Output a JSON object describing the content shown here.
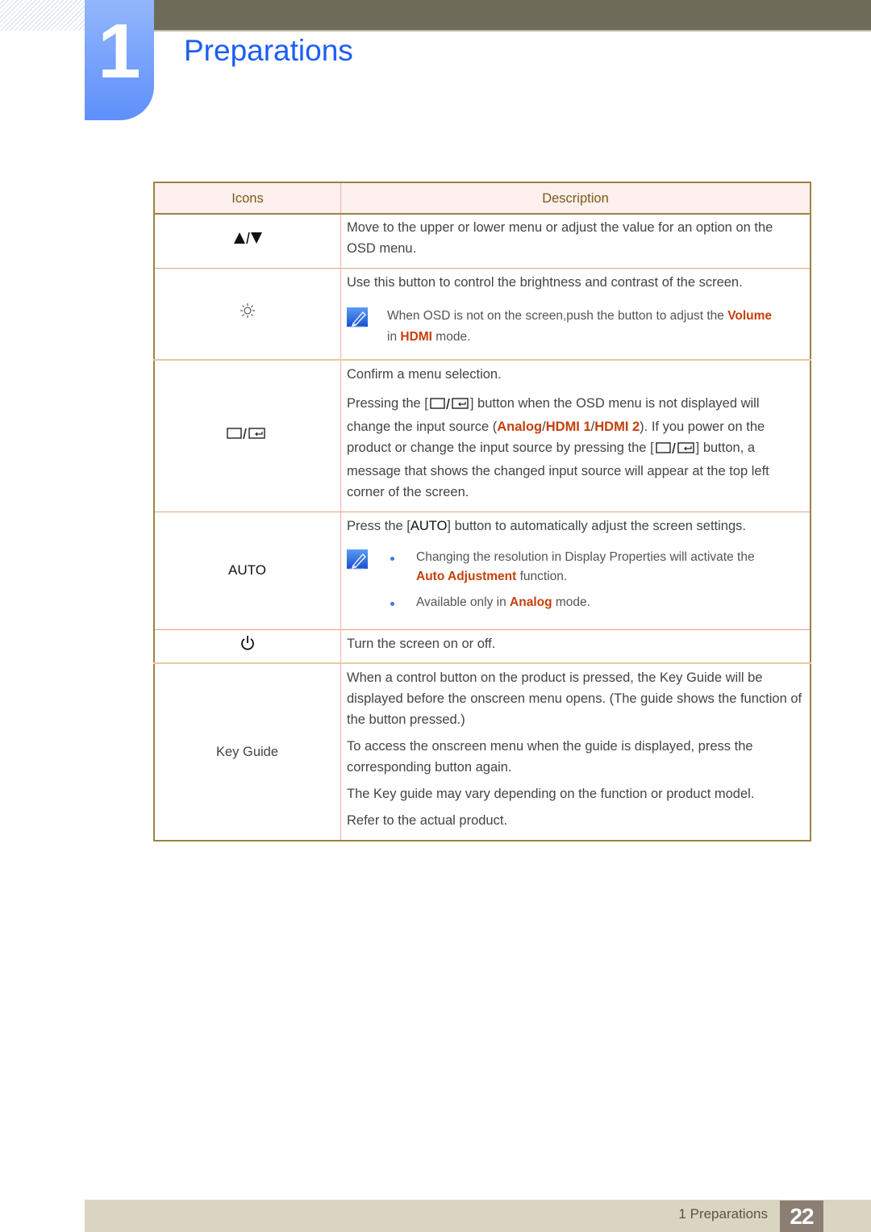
{
  "chapter": {
    "number": "1",
    "title": "Preparations"
  },
  "colors": {
    "accent_blue": "#1c5ef5",
    "highlight_red": "#c5400c",
    "header_text": "#7a5a12",
    "border": "#9b8442"
  },
  "table": {
    "headers": {
      "icons": "Icons",
      "description": "Description"
    },
    "rows": [
      {
        "icon_name": "up-down-arrows-icon",
        "icon_label": "▲/▼",
        "paragraphs": [
          "Move to the upper or lower menu or adjust the value for an option on the OSD menu."
        ]
      },
      {
        "icon_name": "brightness-icon",
        "icon_label": "☼",
        "paragraphs": [
          "Use this button to control the brightness and contrast of the screen."
        ],
        "note": {
          "pre": "When OSD is not on the screen,push the button to adjust the ",
          "hl1": "Volume",
          "mid": " in ",
          "hl2": "HDMI",
          "post": " mode."
        }
      },
      {
        "icon_name": "enter-source-icon",
        "p1": "Confirm a menu selection.",
        "p2": {
          "a": "Pressing the [",
          "b": "] button when the OSD menu is not displayed will change the input source (",
          "hl1": "Analog",
          "slash1": "/",
          "hl2": "HDMI 1",
          "slash2": "/",
          "hl3": "HDMI 2",
          "c": "). If you power on the product or change the input source by pressing the [",
          "d": "] button, a message that shows the changed input source will appear at the top left corner of the screen."
        }
      },
      {
        "icon_name": "auto-label",
        "icon_label": "AUTO",
        "p1": {
          "a": "Press the [",
          "b": "AUTO",
          "c": "] button to automatically adjust the screen settings."
        },
        "bullets": [
          {
            "pre": "Changing the resolution in Display Properties will activate the ",
            "hl": "Auto Adjustment",
            "post": " function."
          },
          {
            "pre": "Available only in ",
            "hl": "Analog",
            "post": " mode."
          }
        ]
      },
      {
        "icon_name": "power-icon",
        "paragraphs": [
          "Turn the screen on or off."
        ]
      },
      {
        "icon_name": "key-guide-label",
        "icon_label": "Key Guide",
        "paragraphs": [
          "When a control button on the product is pressed, the Key Guide will be displayed before the onscreen menu opens. (The guide shows the function of the button pressed.)",
          "To access the onscreen menu when the guide is displayed, press the corresponding button again.",
          "The Key guide may vary depending on the function or product model.",
          "Refer to the actual product."
        ]
      }
    ]
  },
  "footer": {
    "section": "1 Preparations",
    "page": "22"
  }
}
